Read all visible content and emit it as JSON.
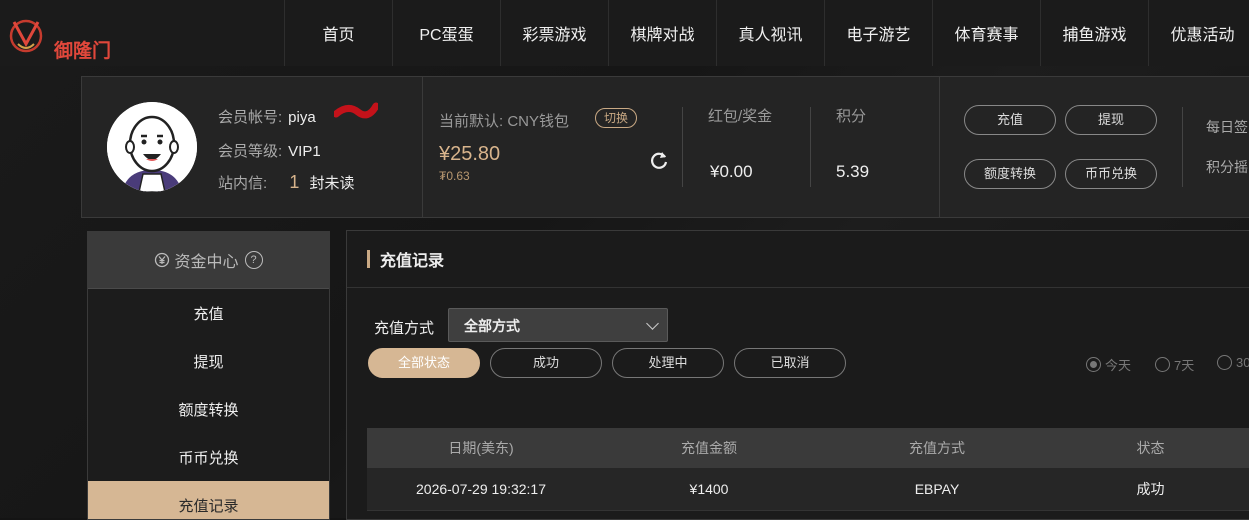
{
  "logo": {
    "text": "御隆门"
  },
  "nav": [
    "首页",
    "PC蛋蛋",
    "彩票游戏",
    "棋牌对战",
    "真人视讯",
    "电子游艺",
    "体育赛事",
    "捕鱼游戏",
    "优惠活动"
  ],
  "profile": {
    "account_label": "会员帐号:",
    "account_value": "piya",
    "level_label": "会员等级:",
    "level_value": "VIP1",
    "messages_label": "站内信:",
    "messages_count": "1",
    "messages_suffix": "封未读"
  },
  "wallet": {
    "label": "当前默认:  CNY钱包",
    "switch_label": "切换",
    "balance": "¥25.80",
    "balance_sub": "₮0.63",
    "bonus_label": "红包/奖金",
    "bonus_value": "¥0.00",
    "points_label": "积分",
    "points_value": "5.39"
  },
  "actions": {
    "deposit": "充值",
    "withdraw": "提现",
    "transfer": "额度转换",
    "exchange": "币币兑换"
  },
  "right_panel": {
    "line1": "每日签",
    "line2": "积分摇"
  },
  "sidebar": {
    "title": "资金中心",
    "help": "?",
    "items": [
      "充值",
      "提现",
      "额度转换",
      "币币兑换",
      "充值记录"
    ]
  },
  "main": {
    "title": "充值记录",
    "method_label": "充值方式",
    "method_value": "全部方式",
    "status_filters": [
      "全部状态",
      "成功",
      "处理中",
      "已取消"
    ],
    "date_filters": [
      "今天",
      "7天",
      "30"
    ],
    "table": {
      "headers": [
        "日期(美东)",
        "充值金额",
        "充值方式",
        "状态"
      ],
      "rows": [
        [
          "2026-07-29 19:32:17",
          "¥1400",
          "EBPAY",
          "成功"
        ]
      ]
    }
  },
  "colors": {
    "accent": "#d6b794",
    "background": "#141414"
  }
}
